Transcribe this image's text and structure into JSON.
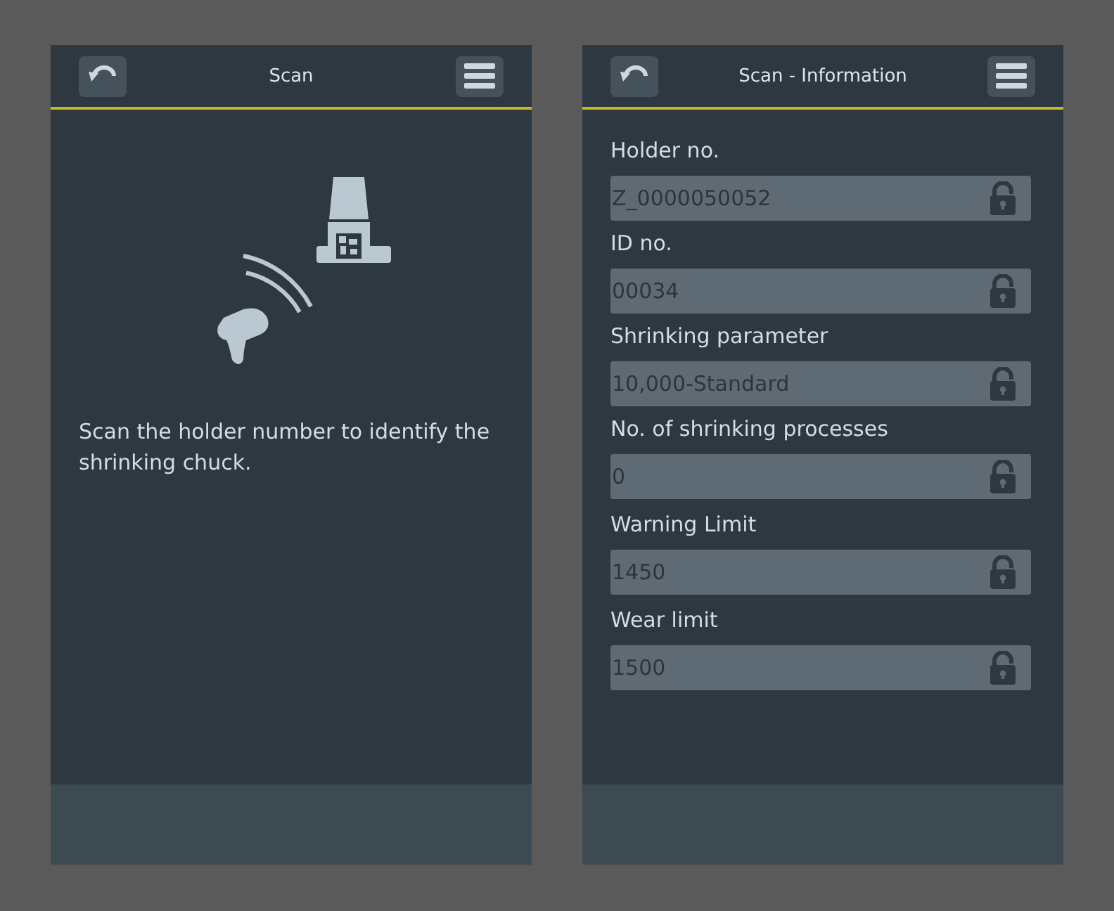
{
  "screens": [
    {
      "title": "Scan",
      "kind": "scan",
      "message": "Scan the holder number to identify the shrinking chuck."
    },
    {
      "title": "Scan - Information",
      "kind": "info",
      "fields": [
        {
          "label": "Holder no.",
          "value": "Z_0000050052",
          "locked": true
        },
        {
          "label": "ID no.",
          "value": "00034",
          "locked": true
        },
        {
          "label": "Shrinking parameter",
          "value": "10,000-Standard",
          "locked": true
        },
        {
          "label": "No. of shrinking processes",
          "value": "0",
          "locked": true
        },
        {
          "label": "Warning Limit",
          "value": "1450",
          "locked": true
        },
        {
          "label": "Wear limit",
          "value": "1500",
          "locked": true
        }
      ]
    }
  ]
}
